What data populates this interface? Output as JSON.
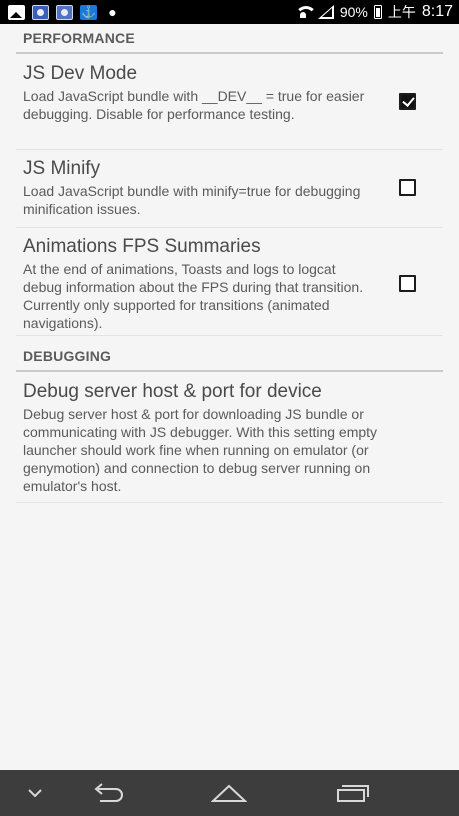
{
  "status_bar": {
    "battery_percent": "90%",
    "time_prefix": "上午",
    "time": "8:17",
    "left_icons": [
      "image-icon",
      "app-icon",
      "app-icon",
      "anchor-icon",
      "android-icon"
    ],
    "right_icons": [
      "wifi-icon",
      "signal-icon",
      "battery-icon"
    ]
  },
  "sections": [
    {
      "title": "PERFORMANCE",
      "items": [
        {
          "title": "JS Dev Mode",
          "summary": "Load JavaScript bundle with __DEV__ = true for easier debugging.  Disable for performance testing.",
          "checked": true
        },
        {
          "title": "JS Minify",
          "summary": "Load JavaScript bundle with minify=true for debugging minification issues.",
          "checked": false
        },
        {
          "title": "Animations FPS Summaries",
          "summary": "At the end of animations, Toasts and logs to logcat debug information about the FPS during that transition. Currently only supported for transitions (animated navigations).",
          "checked": false
        }
      ]
    },
    {
      "title": "DEBUGGING",
      "items": [
        {
          "title": "Debug server host & port for device",
          "summary": "Debug server host & port for downloading JS bundle or communicating with JS debugger. With this setting empty launcher should work fine when running on emulator (or genymotion) and connection to debug server running on emulator's host."
        }
      ]
    }
  ],
  "nav_bar": {
    "buttons": [
      "chevron-down-icon",
      "back-icon",
      "home-icon",
      "recents-icon"
    ],
    "background": "#3d3d3d"
  }
}
